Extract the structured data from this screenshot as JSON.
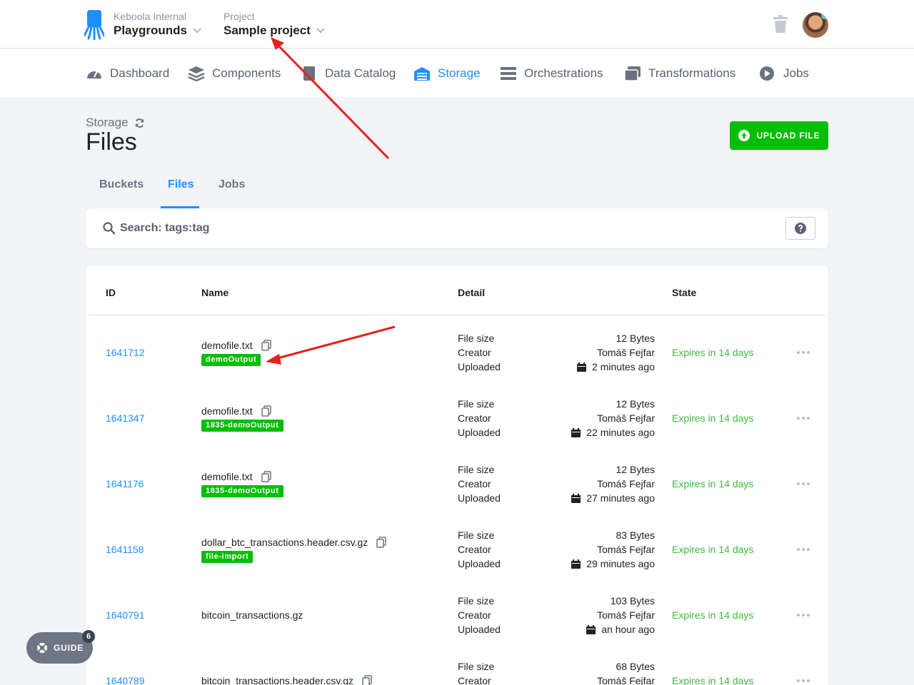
{
  "header": {
    "org_label": "Keboola Internal",
    "org_name": "Playgrounds",
    "project_label": "Project",
    "project_name": "Sample project"
  },
  "nav": {
    "items": [
      {
        "label": "Dashboard",
        "icon": "dashboard-icon"
      },
      {
        "label": "Components",
        "icon": "layers-icon"
      },
      {
        "label": "Data Catalog",
        "icon": "book-icon"
      },
      {
        "label": "Storage",
        "icon": "storage-icon",
        "active": true
      },
      {
        "label": "Orchestrations",
        "icon": "bars-icon"
      },
      {
        "label": "Transformations",
        "icon": "window-icon"
      },
      {
        "label": "Jobs",
        "icon": "play-icon"
      }
    ]
  },
  "page": {
    "breadcrumb": "Storage",
    "title": "Files",
    "upload_label": "UPLOAD FILE"
  },
  "tabs": [
    {
      "label": "Buckets"
    },
    {
      "label": "Files",
      "active": true
    },
    {
      "label": "Jobs"
    }
  ],
  "search": {
    "placeholder": "Search: tags:tag"
  },
  "table": {
    "columns": [
      "ID",
      "Name",
      "Detail",
      "State"
    ],
    "detail_labels": [
      "File size",
      "Creator",
      "Uploaded"
    ],
    "rows": [
      {
        "id": "1641712",
        "name": "demofile.txt",
        "tag": "demoOutput",
        "size": "12 Bytes",
        "creator": "Tomáš Fejfar",
        "uploaded": "2 minutes ago",
        "state": "Expires in 14 days"
      },
      {
        "id": "1641347",
        "name": "demofile.txt",
        "tag": "1835-demoOutput",
        "size": "12 Bytes",
        "creator": "Tomáš Fejfar",
        "uploaded": "22 minutes ago",
        "state": "Expires in 14 days"
      },
      {
        "id": "1641176",
        "name": "demofile.txt",
        "tag": "1835-demoOutput",
        "size": "12 Bytes",
        "creator": "Tomáš Fejfar",
        "uploaded": "27 minutes ago",
        "state": "Expires in 14 days"
      },
      {
        "id": "1641158",
        "name": "dollar_btc_transactions.header.csv.gz",
        "tag": "file-import",
        "size": "83 Bytes",
        "creator": "Tomáš Fejfar",
        "uploaded": "29 minutes ago",
        "state": "Expires in 14 days"
      },
      {
        "id": "1640791",
        "name": "bitcoin_transactions.gz",
        "tag": "",
        "size": "103 Bytes",
        "creator": "Tomáš Fejfar",
        "uploaded": "an hour ago",
        "state": "Expires in 14 days"
      },
      {
        "id": "1640789",
        "name": "bitcoin_transactions.header.csv.gz",
        "tag": "",
        "size": "68 Bytes",
        "creator": "Tomáš Fejfar",
        "uploaded": "",
        "state": "Expires in 14 days"
      }
    ]
  },
  "guide": {
    "label": "GUIDE",
    "badge": "6"
  },
  "colors": {
    "accent": "#1f8fff",
    "success": "#07be07",
    "annotation": "#e8201c"
  }
}
